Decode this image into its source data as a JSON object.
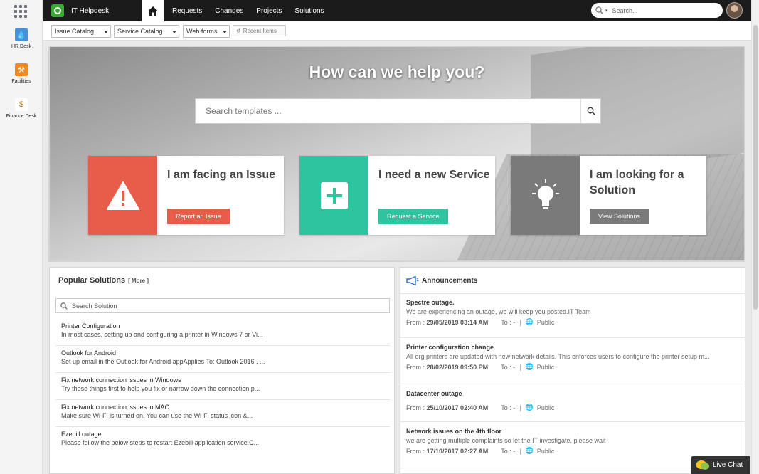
{
  "rail": {
    "items": [
      {
        "label": "HR Desk",
        "color": "#4a90d9"
      },
      {
        "label": "Facilities",
        "color": "#f08a24"
      },
      {
        "label": "Finance Desk",
        "color": "#d9a23a"
      }
    ]
  },
  "topbar": {
    "brand": "IT Helpdesk",
    "nav": [
      "Requests",
      "Changes",
      "Projects",
      "Solutions"
    ],
    "search_placeholder": "Search..."
  },
  "toolbar": {
    "dropdowns": [
      "Issue Catalog",
      "Service Catalog",
      "Web forms"
    ],
    "recent": "Recent Items"
  },
  "hero": {
    "title": "How can we help you?",
    "search_placeholder": "Search templates ...",
    "cards": [
      {
        "title": "I am facing an Issue",
        "button": "Report an Issue",
        "color": "#e85c4a",
        "icon": "warning-icon"
      },
      {
        "title": "I need a new Service",
        "button": "Request a Service",
        "color": "#2ec4a0",
        "icon": "plus-icon"
      },
      {
        "title": "I am looking for a Solution",
        "button": "View Solutions",
        "color": "#7a7a7a",
        "icon": "lightbulb-icon"
      }
    ]
  },
  "solutions": {
    "title": "Popular Solutions",
    "more": "[ More ]",
    "search_placeholder": "Search Solution",
    "items": [
      {
        "title": "Printer Configuration",
        "desc": "In most cases, setting up and configuring a printer in Windows 7 or Vi..."
      },
      {
        "title": "Outlook for Android",
        "desc": "Set up email in the Outlook for Android appApplies To: Outlook 2016 , ..."
      },
      {
        "title": "Fix network connection issues in Windows",
        "desc": "Try these things first to help you fix or narrow down the connection p..."
      },
      {
        "title": "Fix network connection issues in MAC",
        "desc": "Make sure Wi-Fi is turned on. You can use the Wi-Fi status icon &..."
      },
      {
        "title": "Ezebill outage",
        "desc": "Please follow the below steps to restart Ezebill application service.C..."
      }
    ]
  },
  "announcements": {
    "title": "Announcements",
    "items": [
      {
        "title": "Spectre outage.",
        "desc": "We are experiencing an outage, we will keep you posted.IT Team",
        "from": "29/05/2019 03:14 AM",
        "to": "-",
        "visibility": "Public"
      },
      {
        "title": "Printer configuration change",
        "desc": "All org printers are updated with new network details. This enforces users to configure the printer setup m...",
        "from": "28/02/2019 09:50 PM",
        "to": "-",
        "visibility": "Public"
      },
      {
        "title": "Datacenter outage",
        "desc": "",
        "from": "25/10/2017 02:40 AM",
        "to": "-",
        "visibility": "Public"
      },
      {
        "title": "Network issues on the 4th floor",
        "desc": "we are getting multiple complaints so let the IT investigate, please wait",
        "from": "17/10/2017 02:27 AM",
        "to": "-",
        "visibility": "Public"
      }
    ],
    "from_label": "From :",
    "to_label": "To :"
  },
  "livechat": "Live Chat"
}
